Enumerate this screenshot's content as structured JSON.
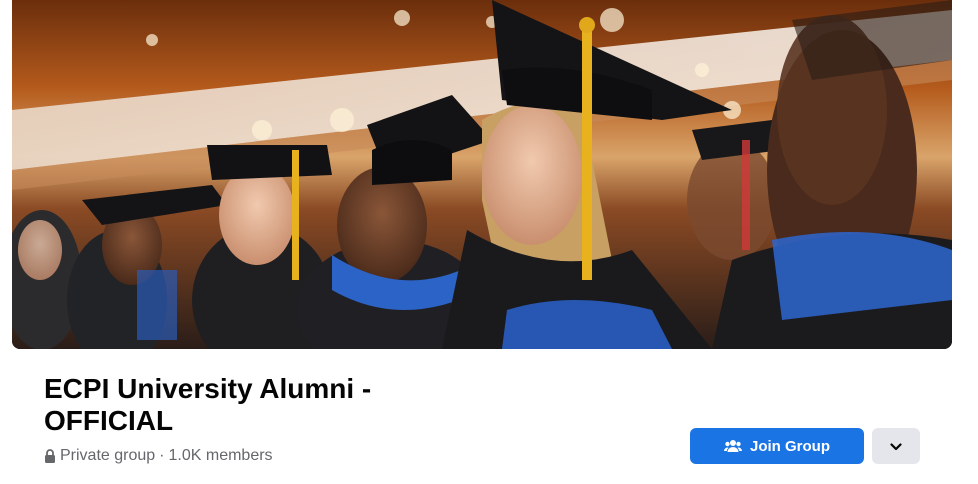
{
  "group": {
    "title": "ECPI University Alumni - OFFICIAL",
    "privacy": "Private group",
    "separator": "·",
    "members": "1.0K members"
  },
  "actions": {
    "join_label": "Join Group",
    "join_icon": "people-icon",
    "more_icon": "chevron-down-icon"
  },
  "cover": {
    "alt": "Graduates in caps and gowns at commencement ceremony"
  },
  "colors": {
    "primary": "#1b74e4",
    "secondary_button": "#e4e6eb",
    "title_text": "#050505",
    "meta_text": "#65676b"
  }
}
